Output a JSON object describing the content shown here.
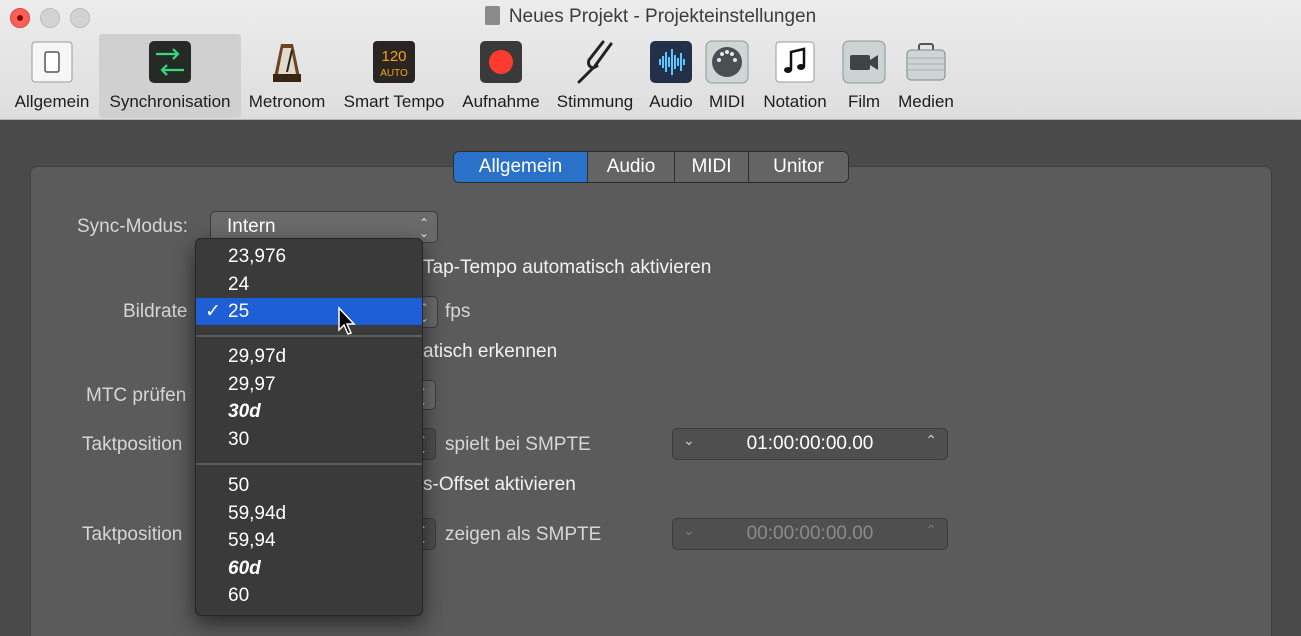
{
  "window": {
    "title": "Neues Projekt - Projekteinstellungen"
  },
  "toolbar": [
    {
      "label": "Allgemein",
      "icon": "switch-icon"
    },
    {
      "label": "Synchronisation",
      "icon": "sync-arrows-icon"
    },
    {
      "label": "Metronom",
      "icon": "metronome-icon"
    },
    {
      "label": "Smart Tempo",
      "icon": "smart-tempo-icon",
      "icon_text": "120",
      "icon_subtext": "AUTO"
    },
    {
      "label": "Aufnahme",
      "icon": "record-icon"
    },
    {
      "label": "Stimmung",
      "icon": "tuning-fork-icon"
    },
    {
      "label": "Audio",
      "icon": "waveform-icon"
    },
    {
      "label": "MIDI",
      "icon": "midi-port-icon"
    },
    {
      "label": "Notation",
      "icon": "music-note-icon"
    },
    {
      "label": "Film",
      "icon": "video-camera-icon"
    },
    {
      "label": "Medien",
      "icon": "briefcase-icon"
    }
  ],
  "tabs": [
    "Allgemein",
    "Audio",
    "MIDI",
    "Unitor"
  ],
  "form": {
    "sync_mode_label": "Sync-Modus:",
    "sync_mode_value": "Intern",
    "tap_tempo_label": "Tap-Tempo automatisch aktivieren",
    "framerate_label": "Bildrate",
    "framerate_unit": "fps",
    "auto_detect_label": "atisch erkennen",
    "mtc_label": "MTC prüfen",
    "bar_pos_1_label": "Taktposition",
    "plays_at_label": "spielt bei SMPTE",
    "smpte_1": "01:00:00:00.00",
    "offset_label": "s-Offset aktivieren",
    "bar_pos_2_label": "Taktposition",
    "show_as_label": "zeigen als SMPTE",
    "smpte_2": "00:00:00:00.00"
  },
  "framerate_menu": {
    "selected": "25",
    "groups": [
      [
        "23,976",
        "24",
        "25"
      ],
      [
        "29,97d",
        "29,97",
        "30d",
        "30"
      ],
      [
        "50",
        "59,94d",
        "59,94",
        "60d",
        "60"
      ]
    ],
    "bold_italic": [
      "30d",
      "60d"
    ]
  },
  "colors": {
    "accent": "#2a72c9",
    "highlight": "#1f5fd6",
    "record": "#ff3b30"
  }
}
